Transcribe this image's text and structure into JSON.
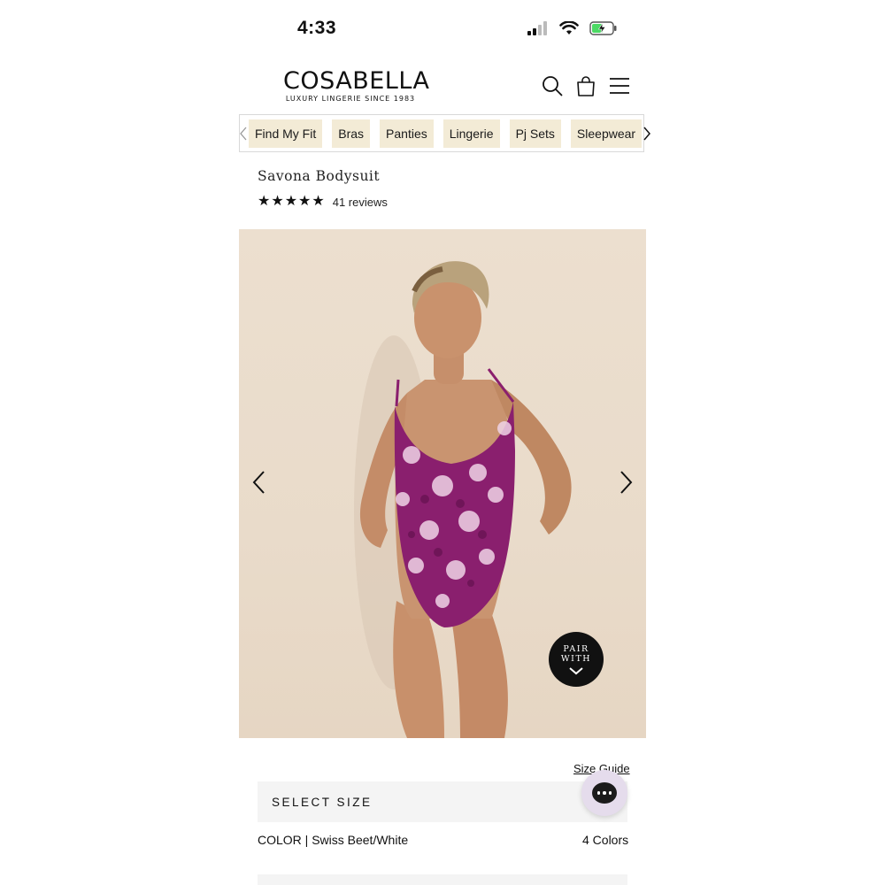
{
  "status_bar": {
    "time": "4:33"
  },
  "header": {
    "logo_main": "COSABELLA",
    "logo_sub": "LUXURY LINGERIE SINCE 1983"
  },
  "categories": [
    "Find My Fit",
    "Bras",
    "Panties",
    "Lingerie",
    "Pj Sets",
    "Sleepwear"
  ],
  "product": {
    "title": "Savona Bodysuit",
    "rating_stars": 5,
    "reviews": "41 reviews",
    "pair_with_line1": "PAIR",
    "pair_with_line2": "WITH"
  },
  "size": {
    "guide_label": "Size Guide",
    "select_label": "SELECT SIZE"
  },
  "color": {
    "label": "COLOR | Swiss Beet/White",
    "count": "4 Colors"
  },
  "colors": {
    "nav_bg": "#f3ebd6",
    "image_bg": "#ecdfcf",
    "garment": "#8a1f6e",
    "battery_green": "#4cd964"
  }
}
